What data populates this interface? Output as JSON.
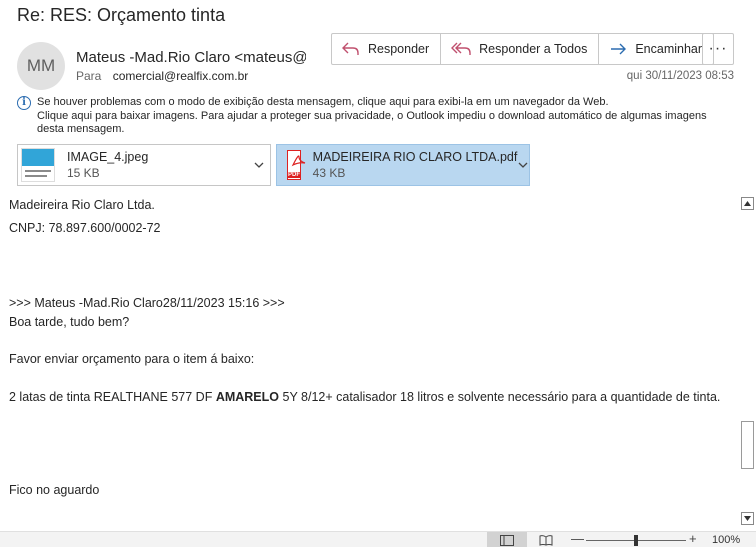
{
  "subject": "Re: RES: Orçamento tinta",
  "sender": {
    "initials": "MM",
    "name": "Mateus -Mad.Rio Claro <mateus@",
    "to_label": "Para",
    "to_value": "comercial@realfix.com.br",
    "date": "qui 30/11/2023 08:53"
  },
  "actions": {
    "reply": "Responder",
    "reply_all": "Responder a Todos",
    "forward": "Encaminhar",
    "more": "···"
  },
  "info_bar": {
    "line1": "Se houver problemas com o modo de exibição desta mensagem, clique aqui para exibi-la em um navegador da Web.",
    "line2": "Clique aqui para baixar imagens. Para ajudar a proteger sua privacidade, o Outlook impediu o download automático de algumas imagens desta mensagem."
  },
  "attachments": [
    {
      "name": "IMAGE_4.jpeg",
      "size": "15 KB",
      "icon": "image-thumbnail-icon"
    },
    {
      "name": "MADEIREIRA RIO CLARO LTDA.pdf",
      "size": "43 KB",
      "icon": "pdf-icon",
      "pdf_label": "PDF"
    }
  ],
  "body": {
    "company": "Madeireira Rio Claro Ltda.",
    "cnpj": "CNPJ: 78.897.600/0002-72",
    "quote_header": ">>> Mateus -Mad.Rio Claro28/11/2023 15:16 >>>",
    "greeting": "Boa tarde, tudo bem?",
    "request": "Favor enviar orçamento para o item á baixo:",
    "item_prefix": "2 latas de tinta REALTHANE 577 DF ",
    "item_bold": "AMARELO",
    "item_suffix": " 5Y 8/12+ catalisador 18 litros e solvente necessário para a quantidade de tinta.",
    "closing": "Fico no aguardo"
  },
  "statusbar": {
    "zoom_minus": "—",
    "zoom_plus": "+",
    "zoom": "100%",
    "zoom_percent": 100
  },
  "colors": {
    "accent": "#2b6cb0",
    "selected_attachment": "#b9d7f0",
    "reply_icon": "#c0506e",
    "forward_icon": "#2b6cb0"
  }
}
